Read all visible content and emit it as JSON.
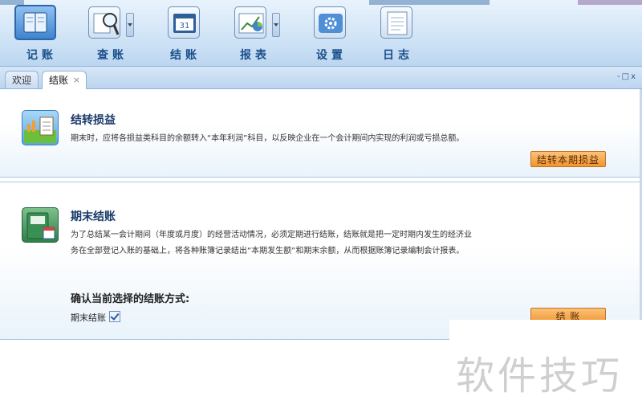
{
  "toolbar": {
    "buttons": [
      {
        "label": "记账",
        "icon": "ledger-book-icon"
      },
      {
        "label": "查账",
        "icon": "magnifier-icon"
      },
      {
        "label": "结账",
        "icon": "calendar-icon",
        "calendar_day": "31"
      },
      {
        "label": "报表",
        "icon": "chart-report-icon"
      },
      {
        "label": "设置",
        "icon": "gear-icon"
      },
      {
        "label": "日志",
        "icon": "log-notebook-icon"
      }
    ]
  },
  "tabs": [
    {
      "label": "欢迎",
      "active": false
    },
    {
      "label": "结账",
      "active": true,
      "close": "×"
    }
  ],
  "window_controls": "-□x",
  "panel_transfer": {
    "title": "结转损益",
    "description": "期末时，应将各损益类科目的余额转入“本年利润”科目，以反映企业在一个会计期间内实现的利润或亏损总额。",
    "button_label": "结转本期损益"
  },
  "panel_close": {
    "title": "期末结账",
    "description_line1": "为了总结某一会计期间（年度或月度）的经营活动情况，必须定期进行结账，结账就是把一定时期内发生的经济业",
    "description_line2": "务在全部登记入账的基础上，将各种账簿记录结出“本期发生额”和期末余额，从而根据账簿记录编制会计报表。",
    "confirm_label": "确认当前选择的结账方式:",
    "checkbox_label": "期末结账",
    "checkbox_checked": true,
    "button_label": "结 账"
  },
  "watermark": "软件技巧",
  "colors": {
    "accent_blue": "#1a4f8b",
    "orange_button": "#f1952f",
    "toolbar_bg": "#cfe3f6"
  }
}
